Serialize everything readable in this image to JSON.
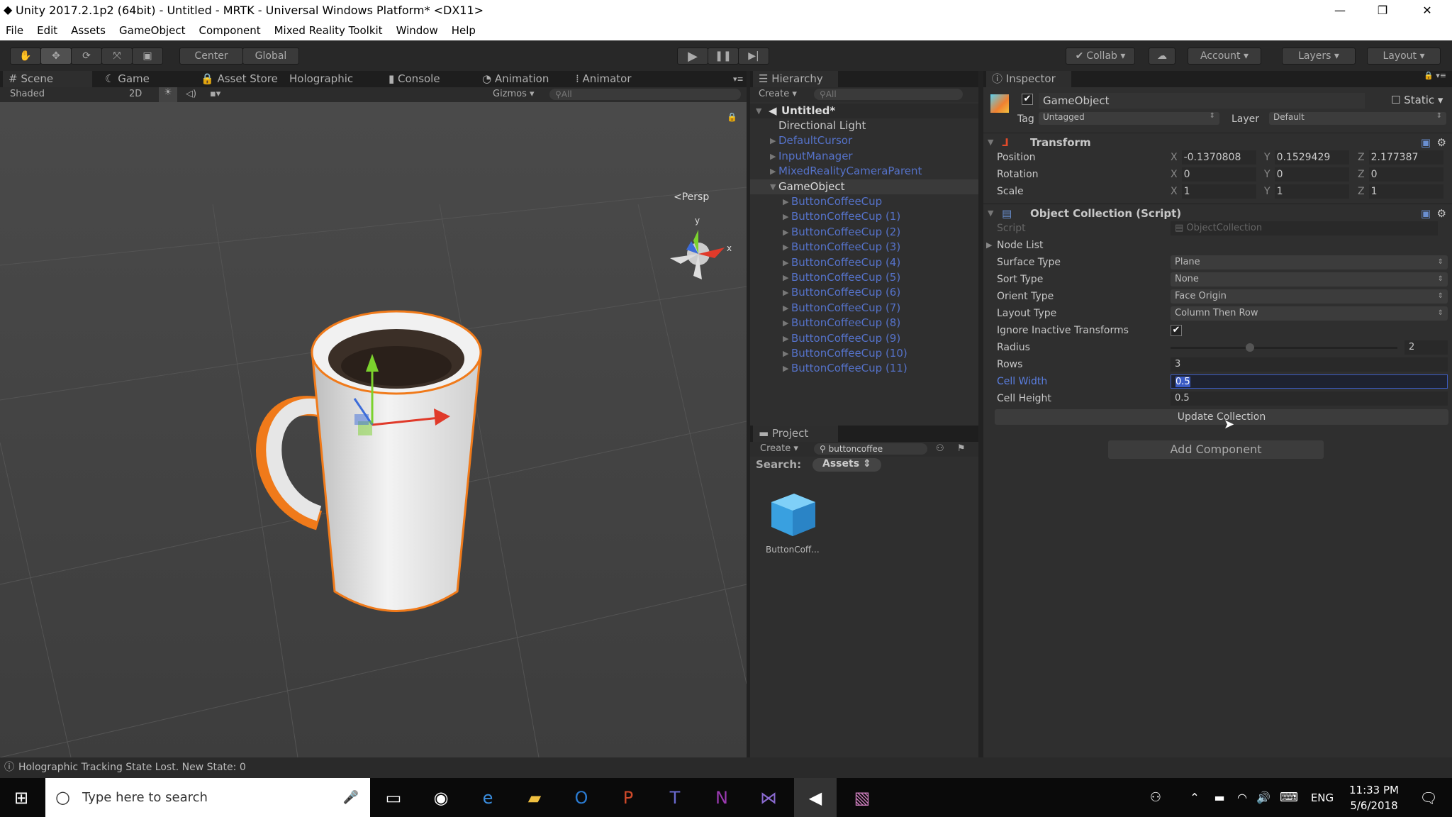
{
  "window": {
    "title": "Unity 2017.2.1p2 (64bit) - Untitled - MRTK - Universal Windows Platform* <DX11>",
    "minimize": "—",
    "restore": "❐",
    "close": "✕"
  },
  "menu": [
    "File",
    "Edit",
    "Assets",
    "GameObject",
    "Component",
    "Mixed Reality Toolkit",
    "Window",
    "Help"
  ],
  "toolbar": {
    "center": "Center",
    "global": "Global",
    "collab": "Collab ▾",
    "account": "Account ▾",
    "layers": "Layers ▾",
    "layout": "Layout ▾"
  },
  "scene_tabs": [
    "Scene",
    "Game",
    "Asset Store",
    "Holographic",
    "Console",
    "Animation",
    "Animator"
  ],
  "scene_bar": {
    "shaded": "Shaded",
    "mode2d": "2D",
    "gizmos": "Gizmos ▾",
    "search": "All",
    "persp": "Persp"
  },
  "hierarchy": {
    "title": "Hierarchy",
    "create": "Create ▾",
    "search": "All",
    "scene": "Untitled*",
    "items": [
      {
        "label": "Directional Light",
        "color": "normal"
      },
      {
        "label": "DefaultCursor",
        "color": "prefab"
      },
      {
        "label": "InputManager",
        "color": "prefab"
      },
      {
        "label": "MixedRealityCameraParent",
        "color": "prefab"
      },
      {
        "label": "GameObject",
        "color": "selected"
      }
    ],
    "children": [
      "ButtonCoffeeCup",
      "ButtonCoffeeCup (1)",
      "ButtonCoffeeCup (2)",
      "ButtonCoffeeCup (3)",
      "ButtonCoffeeCup (4)",
      "ButtonCoffeeCup (5)",
      "ButtonCoffeeCup (6)",
      "ButtonCoffeeCup (7)",
      "ButtonCoffeeCup (8)",
      "ButtonCoffeeCup (9)",
      "ButtonCoffeeCup (10)",
      "ButtonCoffeeCup (11)"
    ]
  },
  "project": {
    "title": "Project",
    "create": "Create ▾",
    "search": "buttoncoffee",
    "search_label": "Search:",
    "scope": "Assets",
    "asset": "ButtonCoff..."
  },
  "inspector": {
    "title": "Inspector",
    "name": "GameObject",
    "static": "Static",
    "tag_label": "Tag",
    "tag": "Untagged",
    "layer_label": "Layer",
    "layer": "Default",
    "transform": {
      "title": "Transform",
      "rows": [
        {
          "label": "Position",
          "x": "-0.1370808",
          "y": "0.1529429",
          "z": "2.177387"
        },
        {
          "label": "Rotation",
          "x": "0",
          "y": "0",
          "z": "0"
        },
        {
          "label": "Scale",
          "x": "1",
          "y": "1",
          "z": "1"
        }
      ]
    },
    "collection": {
      "title": "Object Collection (Script)",
      "script_label": "Script",
      "script": "ObjectCollection",
      "node_list": "Node List",
      "surface_label": "Surface Type",
      "surface": "Plane",
      "sort_label": "Sort Type",
      "sort": "None",
      "orient_label": "Orient Type",
      "orient": "Face Origin",
      "layout_label": "Layout Type",
      "layout": "Column Then Row",
      "ignore_label": "Ignore Inactive Transforms",
      "radius_label": "Radius",
      "radius": "2",
      "radius_fraction": 0.35,
      "rows_label": "Rows",
      "rows": "3",
      "cw_label": "Cell Width",
      "cw": "0.5",
      "ch_label": "Cell Height",
      "ch": "0.5",
      "update": "Update Collection"
    },
    "add_component": "Add Component"
  },
  "status": "Holographic Tracking State Lost. New State: 0",
  "taskbar": {
    "search": "Type here to search",
    "lang": "ENG",
    "time": "11:33 PM",
    "date": "5/6/2018"
  },
  "colors": {
    "selection": "#3b5bc4",
    "prefab": "#5572c9",
    "outline": "#f07a1a"
  }
}
